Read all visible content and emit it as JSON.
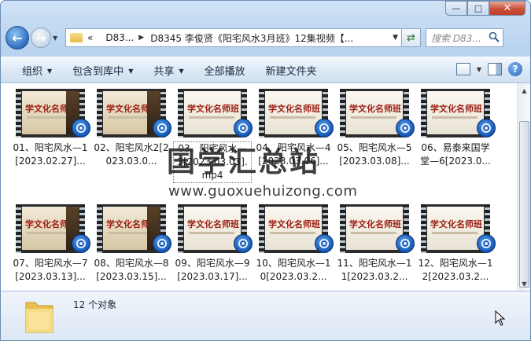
{
  "window": {
    "minimize": "—",
    "maximize": "□",
    "close": "✕"
  },
  "address": {
    "chevrons": "«",
    "crumb1": "D83...",
    "crumb2": "D8345 李俊贤《阳宅风水3月班》12集视频【..."
  },
  "search": {
    "placeholder": "搜索 D83..."
  },
  "toolbar": {
    "items": [
      "组织",
      "包含到库中",
      "共享",
      "全部播放",
      "新建文件夹"
    ]
  },
  "files": [
    {
      "name": "01、阳宅风水—1[2023.02.27]..."
    },
    {
      "name": "02、阳宅风水2[2023.03.0..."
    },
    {
      "name": "03、阳宅风水—3[2023.03.03].mp4"
    },
    {
      "name": "04、阳宅风水—4[2023.03.06]..."
    },
    {
      "name": "05、阳宅风水—5[2023.03.08]..."
    },
    {
      "name": "06、易泰来国学堂—6[2023.0..."
    },
    {
      "name": "07、阳宅风水—7[2023.03.13]..."
    },
    {
      "name": "08、阳宅风水—8[2023.03.15]..."
    },
    {
      "name": "09、阳宅风水—9[2023.03.17]..."
    },
    {
      "name": "10、阳宅风水—10[2023.03.2..."
    },
    {
      "name": "11、阳宅风水—11[2023.03.2..."
    },
    {
      "name": "12、阳宅风水—12[2023.03.2..."
    }
  ],
  "thumb_banner": "学文化名师班",
  "watermark": {
    "text": "国学汇总站",
    "url": "www.guoxuehuizong.com"
  },
  "status": {
    "count": "12 个对象"
  }
}
